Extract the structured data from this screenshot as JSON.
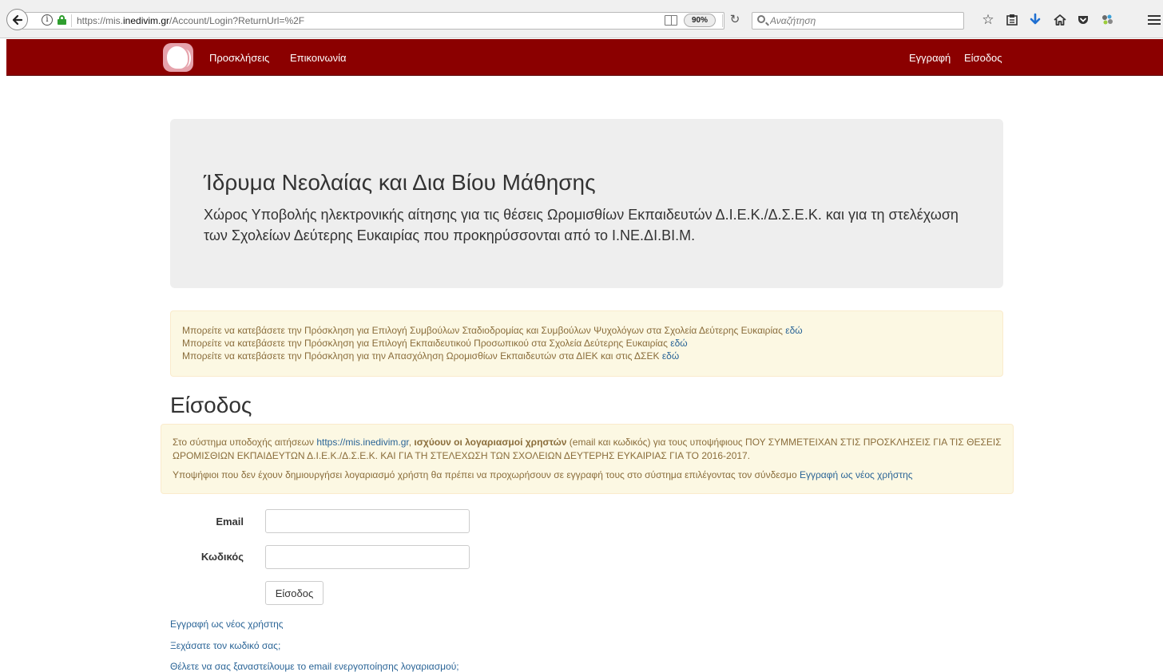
{
  "browser": {
    "url_prefix": "https://mis.",
    "url_domain": "inedivim.gr",
    "url_path": "/Account/Login?ReturnUrl=%2F",
    "zoom": "90%",
    "search_placeholder": "Αναζήτηση",
    "icons": [
      "back-arrow-icon",
      "info-icon",
      "lock-icon",
      "reader-view-icon",
      "reload-icon",
      "search-icon",
      "star-icon",
      "library-icon",
      "download-icon",
      "home-icon",
      "pocket-icon",
      "extension-icon",
      "menu-icon"
    ]
  },
  "navbar": {
    "brand_color": "#8b0000",
    "left_links": [
      "Προσκλήσεις",
      "Επικοινωνία"
    ],
    "right_links": [
      "Εγγραφή",
      "Είσοδος"
    ]
  },
  "jumbotron": {
    "title": "Ίδρυμα Νεολαίας και Δια Βίου Μάθησης",
    "subtitle": "Χώρος Υποβολής ηλεκτρονικής αίτησης για τις θέσεις Ωρομισθίων Εκπαιδευτών Δ.Ι.Ε.Κ./Δ.Σ.Ε.Κ. και για τη στελέχωση των Σχολείων Δεύτερης Ευκαιρίας που προκηρύσσονται από το Ι.ΝΕ.ΔΙ.ΒΙ.Μ."
  },
  "notices": [
    {
      "text": "Μπορείτε να κατεβάσετε την Πρόσκληση για Επιλογή Συμβούλων Σταδιοδρομίας και Συμβούλων Ψυχολόγων στα Σχολεία Δεύτερης Ευκαιρίας ",
      "link": "εδώ"
    },
    {
      "text": "Μπορείτε να κατεβάσετε την Πρόσκληση για Επιλογή Εκπαιδευτικού Προσωπικού στα Σχολεία Δεύτερης Ευκαιρίας ",
      "link": "εδώ"
    },
    {
      "text": "Μπορείτε να κατεβάσετε την Πρόσκληση για την Απασχόληση Ωρομισθίων Εκπαιδευτών στα ΔΙΕΚ και στις ΔΣΕΚ ",
      "link": "εδώ"
    }
  ],
  "login": {
    "title": "Είσοδος",
    "info_part1": "Στο σύστημα υποδοχής αιτήσεων ",
    "info_link": "https://mis.inedivim.gr",
    "info_part2": ", ",
    "info_bold": "ισχύουν οι λογαριασμοί χρηστών",
    "info_part3": " (email και κωδικός) για τους υποψήφιους ΠΟΥ ΣΥΜΜΕΤΕΙΧΑΝ ΣΤΙΣ ΠΡΟΣΚΛΗΣΕΙΣ ΓΙΑ ΤΙΣ ΘΕΣΕΙΣ ΩΡΟΜΙΣΘΙΩΝ ΕΚΠΑΙΔΕΥΤΩΝ Δ.Ι.Ε.Κ./Δ.Σ.Ε.Κ. ΚΑΙ ΓΙΑ ΤΗ ΣΤΕΛΕΧΩΣΗ ΤΩΝ ΣΧΟΛΕΙΩΝ ΔΕΥΤΕΡΗΣ ΕΥΚΑΙΡΙΑΣ ΓΙΑ ΤΟ 2016-2017.",
    "info2_text": "Υποψήφιοι που δεν έχουν δημιουργήσει λογαριασμό χρήστη θα πρέπει να προχωρήσουν σε εγγραφή τους στο σύστημα επιλέγοντας τον σύνδεσμο ",
    "info2_link": "Εγγραφή ως νέος χρήστης",
    "email_label": "Email",
    "email_value": "",
    "password_label": "Κωδικός",
    "password_value": "",
    "submit_label": "Είσοδος",
    "links": [
      "Εγγραφή ως νέος χρήστης",
      "Ξεχάσατε τον κωδικό σας;",
      "Θέλετε να σας ξαναστείλουμε το email ενεργοποίησης λογαριασμού;"
    ]
  }
}
